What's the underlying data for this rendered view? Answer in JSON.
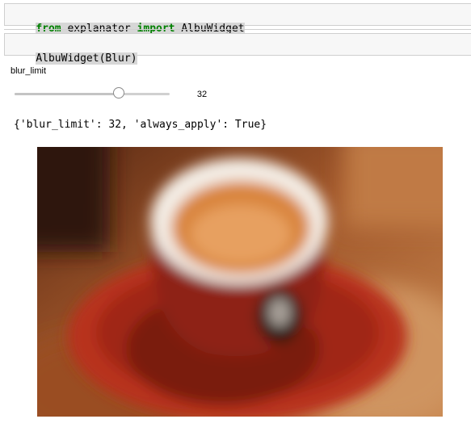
{
  "cells": [
    {
      "tokens": [
        {
          "text": "from",
          "kind": "keyword"
        },
        {
          "text": " explanator ",
          "kind": "plain"
        },
        {
          "text": "import",
          "kind": "keyword"
        },
        {
          "text": " AlbuWidget",
          "kind": "plain"
        }
      ]
    },
    {
      "tokens": [
        {
          "text": "AlbuWidget(Blur)",
          "kind": "plain"
        }
      ]
    }
  ],
  "widget": {
    "label": "blur_limit",
    "slider": {
      "value": 32,
      "min": 3,
      "max": 46,
      "readout": "32"
    },
    "output": "{'blur_limit': 32, 'always_apply': True}"
  },
  "image": {
    "subject": "blurred-espresso-cup",
    "colors": {
      "background": "#8a4a22",
      "saucer": "#b8321a",
      "cup_rim": "#f4eee6",
      "coffee": "#d9853e",
      "shadow": "#2a1208"
    }
  },
  "colors": {
    "keyword": "#008000",
    "cell_background": "#f7f7f7",
    "cell_border": "#cfcfcf",
    "selection": "#d7d7d7"
  }
}
